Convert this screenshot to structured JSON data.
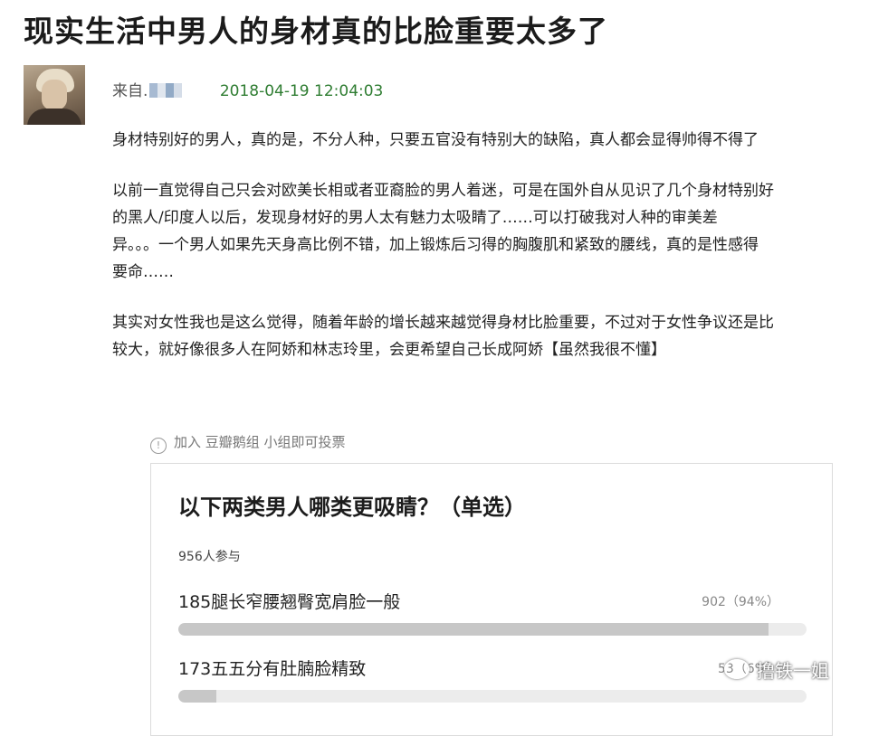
{
  "post": {
    "title": "现实生活中男人的身材真的比脸重要太多了",
    "from_prefix": "来自.",
    "timestamp": "2018-04-19 12:04:03",
    "paragraphs": [
      [
        "身材特别好的男人，真的是，不分人种，只要五官没有特别大的缺陷，真人都会显得帅得不得了"
      ],
      [
        "以前一直觉得自己只会对欧美长相或者亚裔脸的男人着迷，可是在国外自从见识了几个身材特别好",
        "的黑人/印度人以后，发现身材好的男人太有魅力太吸睛了……可以打破我对人种的审美差",
        "异。。。一个男人如果先天身高比例不错，加上锻炼后习得的胸腹肌和紧致的腰线，真的是性感得",
        "要命……"
      ],
      [
        "其实对女性我也是这么觉得，随着年龄的增长越来越觉得身材比脸重要，不过对于女性争议还是比",
        "较大，就好像很多人在阿娇和林志玲里，会更希望自己长成阿娇【虽然我很不懂】"
      ]
    ]
  },
  "notice": {
    "icon": "info-icon",
    "icon_glyph": "!",
    "text": "加入 豆瓣鹅组 小组即可投票"
  },
  "poll": {
    "question": "以下两类男人哪类更吸睛？（单选）",
    "participants": "956人参与",
    "options": [
      {
        "label": "185腿长窄腰翘臀宽肩脸一般",
        "result": "902（94%）",
        "fraction": 0.94
      },
      {
        "label": "173五五分有肚腩脸精致",
        "result": "53（6%）",
        "fraction": 0.06
      }
    ]
  },
  "watermark": {
    "icon": "wechat-logo-icon",
    "text": "撸铁一姐"
  }
}
